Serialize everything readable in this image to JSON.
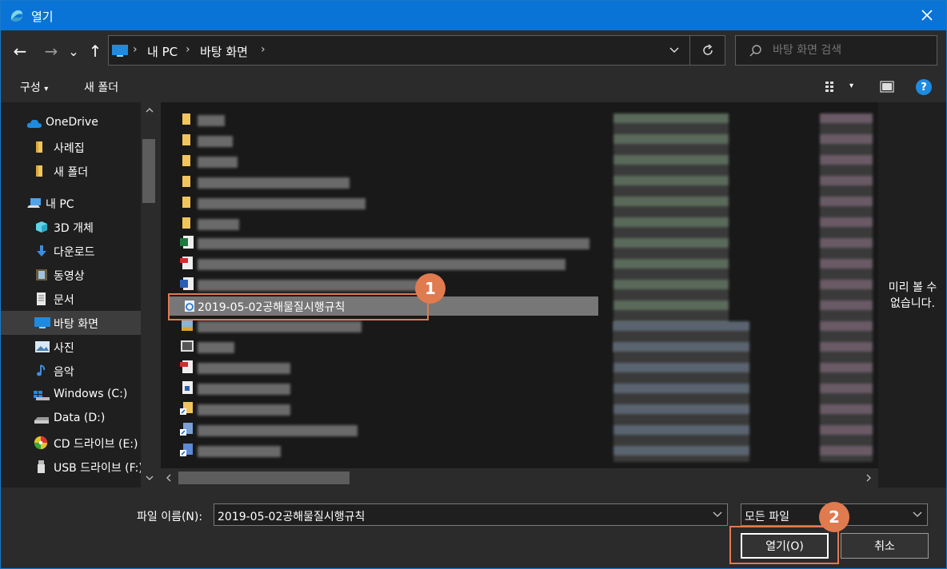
{
  "window": {
    "title": "열기",
    "accent": "#0a74d6",
    "close_icon": "close-icon"
  },
  "nav": {
    "back": "←",
    "forward": "→",
    "recent": "⌄",
    "up": "↑",
    "breadcrumbs": [
      "내 PC",
      "바탕 화면"
    ],
    "search_placeholder": "바탕 화면 검색"
  },
  "toolbar": {
    "organize": "구성",
    "new_folder": "새 폴더",
    "help": "?"
  },
  "sidebar": {
    "items": [
      {
        "label": "OneDrive",
        "icon": "cloud-icon"
      },
      {
        "label": "사례집",
        "icon": "folder-icon"
      },
      {
        "label": "새 폴더",
        "icon": "folder-icon"
      },
      {
        "label": "내 PC",
        "icon": "pc-icon"
      },
      {
        "label": "3D 개체",
        "icon": "cube-icon"
      },
      {
        "label": "다운로드",
        "icon": "download-icon"
      },
      {
        "label": "동영상",
        "icon": "video-icon"
      },
      {
        "label": "문서",
        "icon": "document-icon"
      },
      {
        "label": "바탕 화면",
        "icon": "desktop-icon"
      },
      {
        "label": "사진",
        "icon": "picture-icon"
      },
      {
        "label": "음악",
        "icon": "music-icon"
      },
      {
        "label": "Windows (C:)",
        "icon": "drive-icon"
      },
      {
        "label": "Data (D:)",
        "icon": "drive-icon"
      },
      {
        "label": "CD 드라이브 (E:)",
        "icon": "cd-icon"
      },
      {
        "label": "USB 드라이브 (F:)",
        "icon": "usb-icon"
      }
    ]
  },
  "file_list": {
    "selected_file": "2019-05-02공해물질시행규칙"
  },
  "preview": {
    "text": "미리 볼 수 없습니다."
  },
  "footer": {
    "filename_label": "파일 이름(N):",
    "filename_value": "2019-05-02공해물질시행규칙",
    "filter_value": "모든 파일",
    "open_label": "열기(O)",
    "cancel_label": "취소"
  },
  "annotations": {
    "badge1": "1",
    "badge2": "2",
    "color": "#e07a4f"
  }
}
